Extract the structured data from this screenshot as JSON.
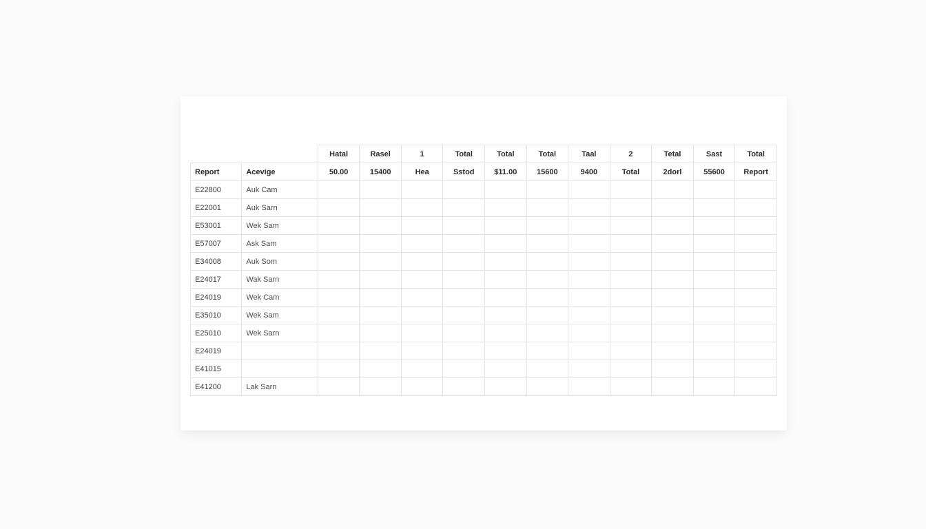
{
  "table": {
    "headers": [
      "",
      "",
      "Hatal",
      "Rasel",
      "1",
      "Total",
      "Total",
      "Total",
      "Taal",
      "2",
      "Tetal",
      "Sast",
      "Total"
    ],
    "subhead": [
      "Report",
      "Acevige",
      "50.00",
      "15400",
      "Hea",
      "Sstod",
      "$11.00",
      "15600",
      "9400",
      "Total",
      "2dorl",
      "55600",
      "Report"
    ],
    "rows": [
      {
        "code": "E22800",
        "name": "Auk Cam",
        "cells": [
          "",
          "",
          "",
          "",
          "",
          "",
          "",
          "",
          "",
          "",
          ""
        ]
      },
      {
        "code": "E22001",
        "name": "Auk Sarn",
        "cells": [
          "",
          "",
          "",
          "",
          "",
          "",
          "",
          "",
          "",
          "",
          ""
        ]
      },
      {
        "code": "E53001",
        "name": "Wek Sam",
        "cells": [
          "",
          "",
          "",
          "",
          "",
          "",
          "",
          "",
          "",
          "",
          ""
        ]
      },
      {
        "code": "E57007",
        "name": "Ask Sam",
        "cells": [
          "",
          "",
          "",
          "",
          "",
          "",
          "",
          "",
          "",
          "",
          ""
        ]
      },
      {
        "code": "E34008",
        "name": "Auk Som",
        "cells": [
          "",
          "",
          "",
          "",
          "",
          "",
          "",
          "",
          "",
          "",
          ""
        ]
      },
      {
        "code": "E24017",
        "name": "Wak Sarn",
        "cells": [
          "",
          "",
          "",
          "",
          "",
          "",
          "",
          "",
          "",
          "",
          ""
        ]
      },
      {
        "code": "E24019",
        "name": "Wek Cam",
        "cells": [
          "",
          "",
          "",
          "",
          "",
          "",
          "",
          "",
          "",
          "",
          ""
        ]
      },
      {
        "code": "E35010",
        "name": "Wek Sam",
        "cells": [
          "",
          "",
          "",
          "",
          "",
          "",
          "",
          "",
          "",
          "",
          ""
        ]
      },
      {
        "code": "E25010",
        "name": "Wek Sarn",
        "cells": [
          "",
          "",
          "",
          "",
          "",
          "",
          "",
          "",
          "",
          "",
          ""
        ]
      },
      {
        "code": "E24019",
        "name": "",
        "cells": [
          "",
          "",
          "",
          "",
          "",
          "",
          "",
          "",
          "",
          "",
          ""
        ]
      },
      {
        "code": "E41015",
        "name": "",
        "cells": [
          "",
          "",
          "",
          "",
          "",
          "",
          "",
          "",
          "",
          "",
          ""
        ]
      },
      {
        "code": "E41200",
        "name": "Lak Sarn",
        "cells": [
          "",
          "",
          "",
          "",
          "",
          "",
          "",
          "",
          "",
          "",
          ""
        ]
      }
    ]
  }
}
